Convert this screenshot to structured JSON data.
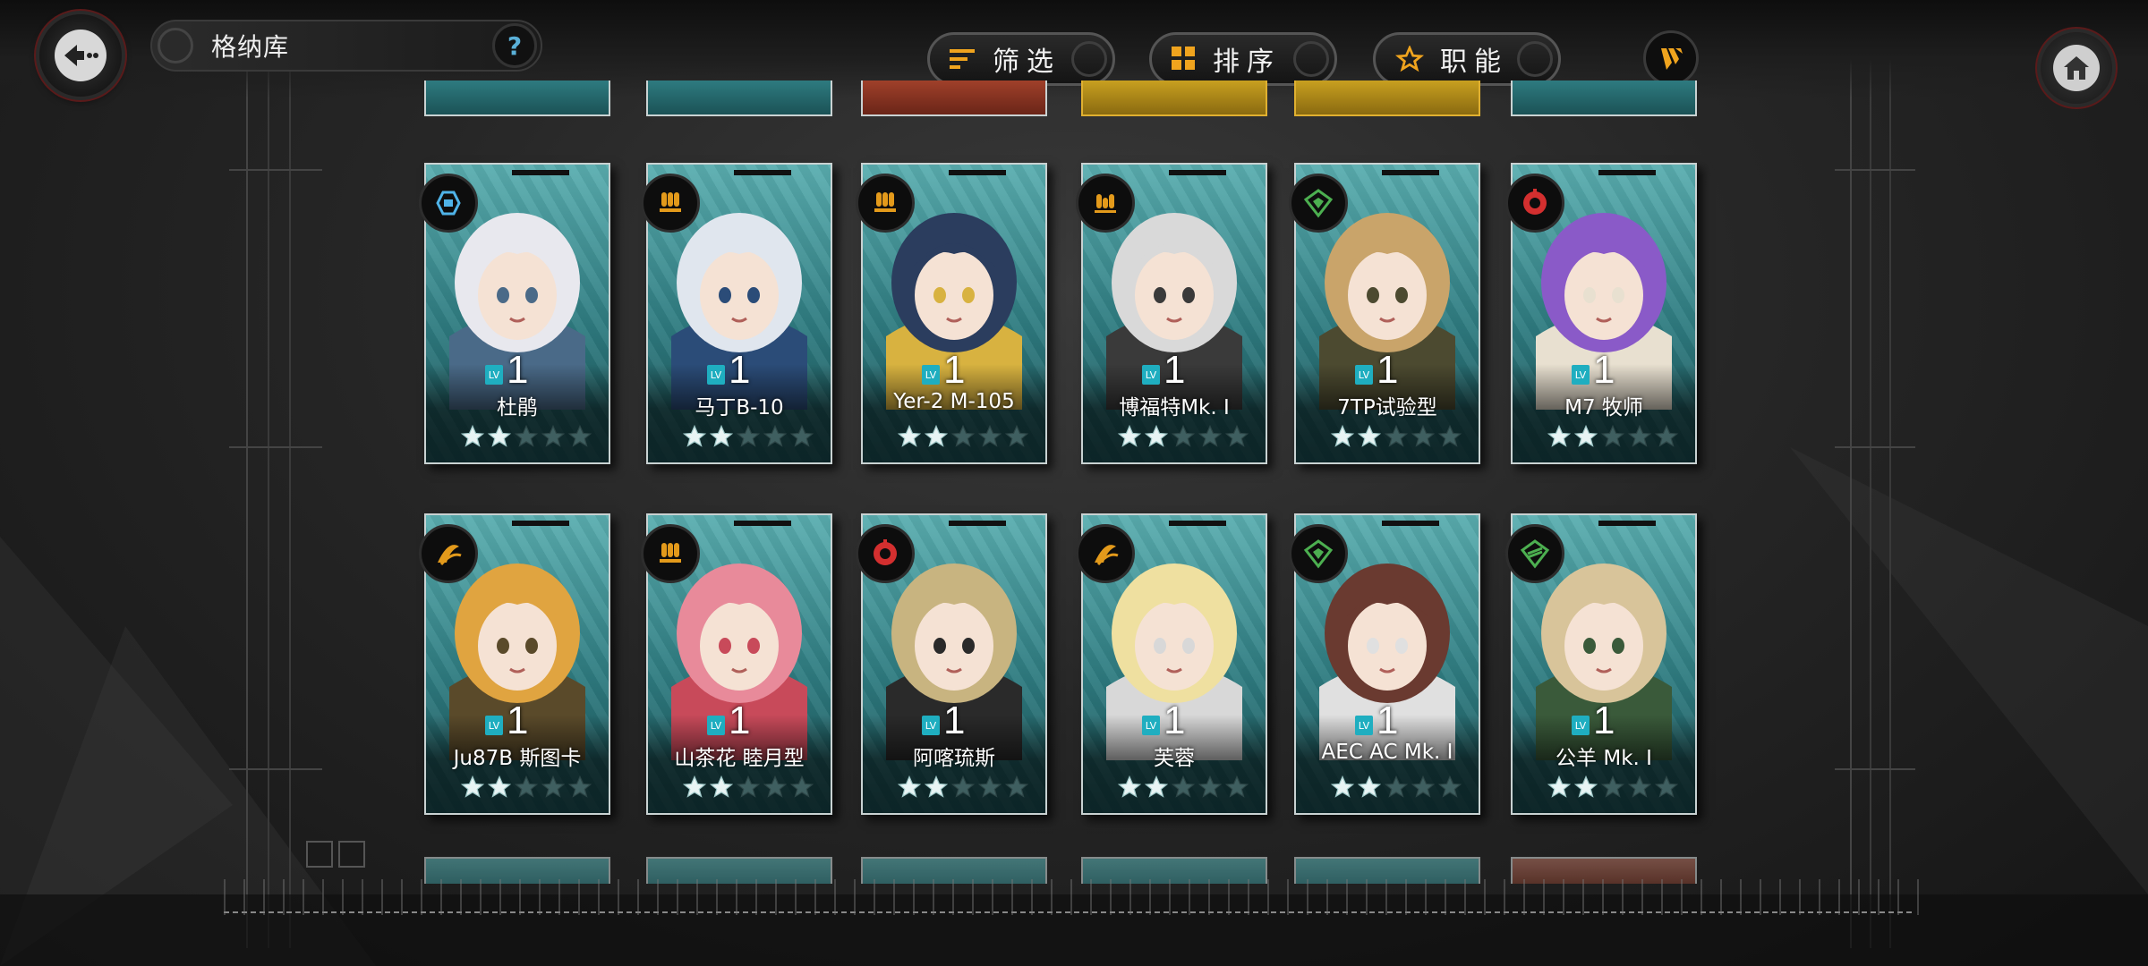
{
  "header": {
    "title": "格纳库",
    "help_label": "?",
    "filter_label": "筛选",
    "sort_label": "排序",
    "role_label": "职能"
  },
  "colors": {
    "accent_orange": "#f0a41e",
    "teal_card": "#3e9598",
    "lv_tag": "#1faec0",
    "role_orange": "#e39a1b",
    "role_green": "#4caf50",
    "role_red": "#d32f2f",
    "role_blue": "#4fb3e8"
  },
  "cards": [
    {
      "name": "杜鹃",
      "level": "1",
      "stars_filled": 2,
      "stars_total": 5,
      "role_icon": "shield-icon",
      "role_color": "#4fb3e8"
    },
    {
      "name": "马丁B-10",
      "level": "1",
      "stars_filled": 2,
      "stars_total": 5,
      "role_icon": "bomb-icon",
      "role_color": "#e39a1b"
    },
    {
      "name": "Yer-2 M-105",
      "level": "1",
      "stars_filled": 2,
      "stars_total": 5,
      "role_icon": "bomb-icon",
      "role_color": "#e39a1b"
    },
    {
      "name": "博福特Mk. I",
      "level": "1",
      "stars_filled": 2,
      "stars_total": 5,
      "role_icon": "torpedo-icon",
      "role_color": "#e39a1b"
    },
    {
      "name": "7TP试验型",
      "level": "1",
      "stars_filled": 2,
      "stars_total": 5,
      "role_icon": "tank-icon",
      "role_color": "#4caf50"
    },
    {
      "name": "M7 牧师",
      "level": "1",
      "stars_filled": 2,
      "stars_total": 5,
      "role_icon": "artillery-icon",
      "role_color": "#d32f2f"
    },
    {
      "name": "Ju87B 斯图卡",
      "level": "1",
      "stars_filled": 2,
      "stars_total": 5,
      "role_icon": "dive-bomb-icon",
      "role_color": "#e39a1b"
    },
    {
      "name": "山茶花 睦月型",
      "level": "1",
      "stars_filled": 2,
      "stars_total": 5,
      "role_icon": "bomb-icon",
      "role_color": "#e39a1b"
    },
    {
      "name": "阿喀琉斯",
      "level": "1",
      "stars_filled": 2,
      "stars_total": 5,
      "role_icon": "artillery-icon",
      "role_color": "#d32f2f"
    },
    {
      "name": "芙蓉",
      "level": "1",
      "stars_filled": 2,
      "stars_total": 5,
      "role_icon": "dive-bomb-icon",
      "role_color": "#e39a1b"
    },
    {
      "name": "AEC AC Mk. I",
      "level": "1",
      "stars_filled": 2,
      "stars_total": 5,
      "role_icon": "tank-icon",
      "role_color": "#4caf50"
    },
    {
      "name": "公羊 Mk. I",
      "level": "1",
      "stars_filled": 2,
      "stars_total": 5,
      "role_icon": "recon-icon",
      "role_color": "#4caf50"
    }
  ]
}
